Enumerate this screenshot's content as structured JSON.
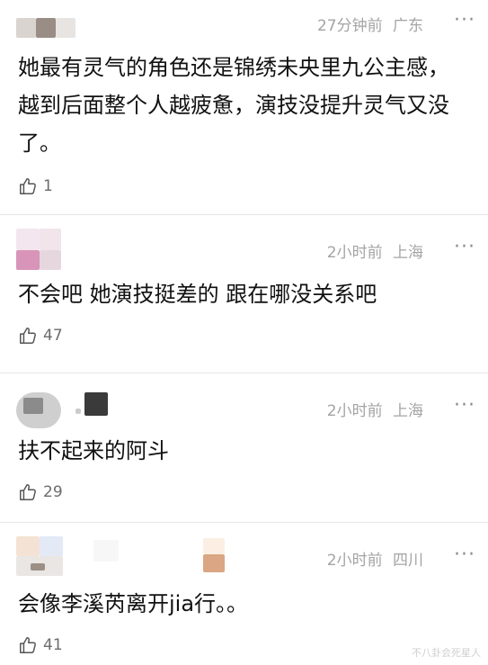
{
  "comments": [
    {
      "time": "27分钟前",
      "location": "广东",
      "more": "···",
      "text": "她最有灵气的角色还是锦绣未央里九公主感，越到后面整个人越疲惫，演技没提升灵气又没了。",
      "likes": "1"
    },
    {
      "time": "2小时前",
      "location": "上海",
      "more": "···",
      "text": "不会吧 她演技挺差的 跟在哪没关系吧",
      "likes": "47"
    },
    {
      "time": "2小时前",
      "location": "上海",
      "more": "···",
      "text": "扶不起来的阿斗",
      "likes": "29"
    },
    {
      "time": "2小时前",
      "location": "四川",
      "more": "···",
      "text": "会像李溪芮离开jia行。。",
      "likes": "41"
    }
  ],
  "watermark": "不八卦会死星人"
}
